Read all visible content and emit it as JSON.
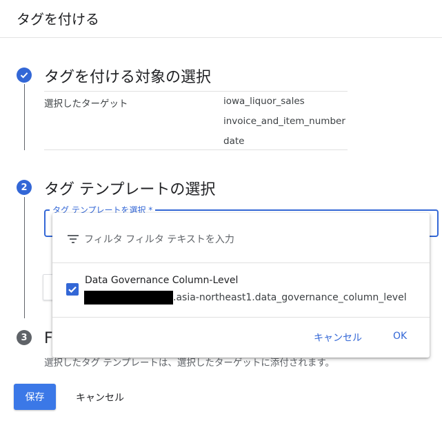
{
  "header": {
    "title": "タグを付ける"
  },
  "steps": [
    {
      "number": "",
      "title": "タグを付ける対象の選択",
      "state": "done",
      "color": "#3367d6"
    },
    {
      "number": "2",
      "title": "タグ テンプレートの選択",
      "state": "active",
      "color": "#3367d6"
    },
    {
      "number": "3",
      "title": "F",
      "state": "pending",
      "color": "#5f6368"
    }
  ],
  "target_summary": {
    "label": "選択したターゲット",
    "values": [
      "iowa_liquor_sales",
      "invoice_and_item_number",
      "date"
    ]
  },
  "template_select": {
    "label": "タグ テンプレートを選択 *",
    "value": ""
  },
  "dropdown": {
    "filter_placeholder": "フィルタ フィルタ テキストを入力",
    "options": [
      {
        "title": "Data Governance Column-Level",
        "path": ".asia-northeast1.data_governance_column_level",
        "checked": true
      }
    ],
    "cancel_label": "キャンセル",
    "ok_label": "OK"
  },
  "step3_description": "選択したタグ テンプレートは、選択したターゲットに添付されます。",
  "footer": {
    "save_label": "保存",
    "cancel_label": "キャンセル"
  },
  "colors": {
    "accent": "#3367d6",
    "save_button": "#3b78e7",
    "step_pending": "#5f6368"
  }
}
